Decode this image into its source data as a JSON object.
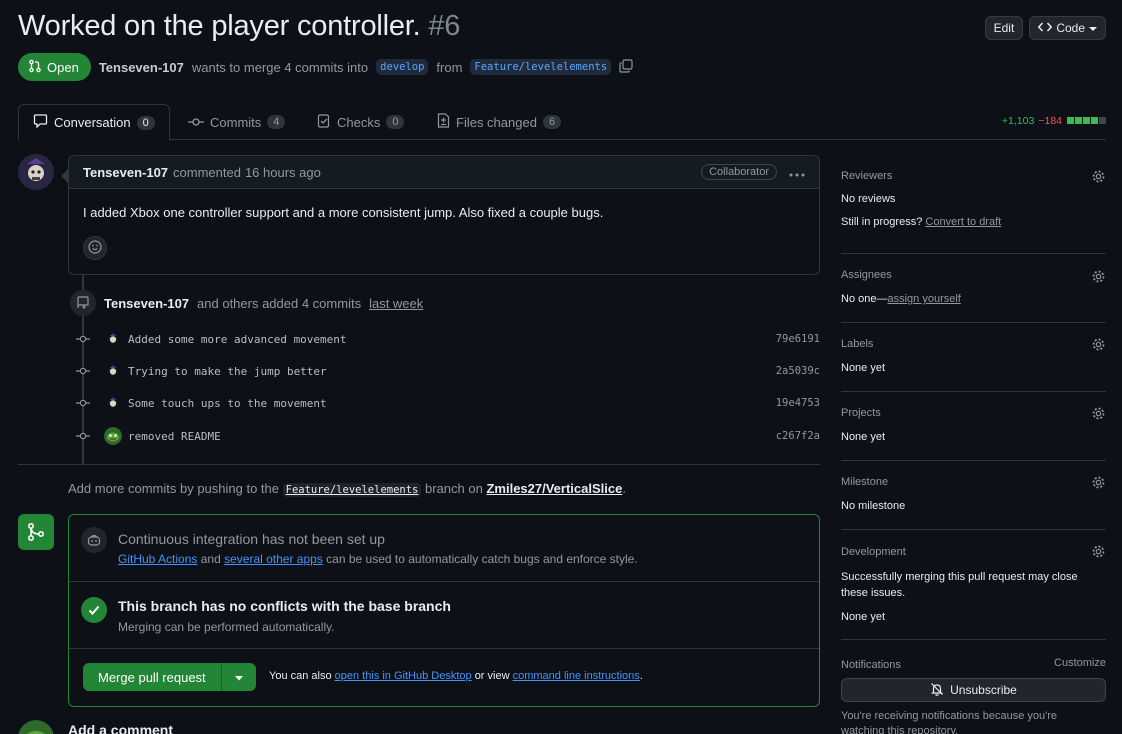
{
  "pr": {
    "title": "Worked on the player controller.",
    "number": "#6",
    "state": "Open",
    "author": "Tenseven-107",
    "merge_text": "wants to merge 4 commits into",
    "base_branch": "develop",
    "from_text": "from",
    "head_branch": "Feature/levelelements"
  },
  "header_buttons": {
    "edit": "Edit",
    "code": "Code"
  },
  "tabs": [
    {
      "label": "Conversation",
      "count": "0"
    },
    {
      "label": "Commits",
      "count": "4"
    },
    {
      "label": "Checks",
      "count": "0"
    },
    {
      "label": "Files changed",
      "count": "6"
    }
  ],
  "diffstat": {
    "additions": "+1,103",
    "deletions": "−184"
  },
  "comment": {
    "author": "Tenseven-107",
    "action": "commented",
    "time": "16 hours ago",
    "role": "Collaborator",
    "body": "I added Xbox one controller support and a more consistent jump. Also fixed a couple bugs."
  },
  "commits_event": {
    "author": "Tenseven-107",
    "text": "and others added 4 commits",
    "time": "last week"
  },
  "commits": [
    {
      "message": "Added some more advanced movement",
      "sha": "79e6191"
    },
    {
      "message": "Trying to make the jump better",
      "sha": "2a5039c"
    },
    {
      "message": "Some touch ups to the movement",
      "sha": "19e4753"
    },
    {
      "message": "removed README",
      "sha": "c267f2a"
    }
  ],
  "push_note": {
    "prefix": "Add more commits by pushing to the",
    "branch": "Feature/levelelements",
    "middle": "branch on",
    "repo": "Zmiles27/VerticalSlice",
    "suffix": "."
  },
  "merge_box": {
    "ci_title": "Continuous integration has not been set up",
    "ci_link1": "GitHub Actions",
    "ci_and": "and",
    "ci_link2": "several other apps",
    "ci_rest": "can be used to automatically catch bugs and enforce style.",
    "conflict_title": "This branch has no conflicts with the base branch",
    "conflict_sub": "Merging can be performed automatically.",
    "merge_button": "Merge pull request",
    "also_prefix": "You can also",
    "also_link1": "open this in GitHub Desktop",
    "also_mid": "or view",
    "also_link2": "command line instructions",
    "also_suffix": "."
  },
  "add_comment": "Add a comment",
  "sidebar": {
    "reviewers_label": "Reviewers",
    "reviewers_val": "No reviews",
    "in_progress": "Still in progress?",
    "convert_draft": "Convert to draft",
    "assignees_label": "Assignees",
    "assignees_val": "No one—",
    "assign_yourself": "assign yourself",
    "labels_label": "Labels",
    "labels_val": "None yet",
    "projects_label": "Projects",
    "projects_val": "None yet",
    "milestone_label": "Milestone",
    "milestone_val": "No milestone",
    "development_label": "Development",
    "development_desc": "Successfully merging this pull request may close these issues.",
    "development_val": "None yet",
    "notifications_label": "Notifications",
    "customize": "Customize",
    "unsubscribe": "Unsubscribe",
    "notif_note": "You're receiving notifications because you're watching this repository."
  },
  "colors": {
    "accent_green": "#238636",
    "link_blue": "#4493f8",
    "bg": "#0d1117"
  }
}
